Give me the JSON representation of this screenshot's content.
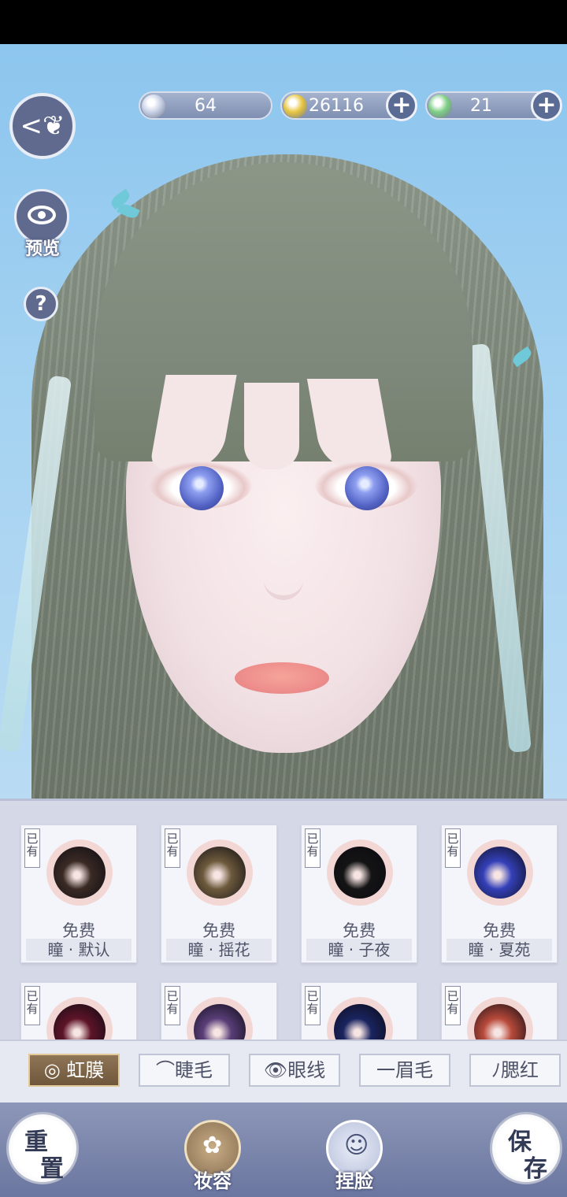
{
  "currencies": [
    {
      "name": "silver-token",
      "value": "64",
      "has_add": false,
      "color": "#c9d2e6"
    },
    {
      "name": "gold-coin",
      "value": "26116",
      "has_add": true,
      "color": "#e8c640"
    },
    {
      "name": "jade-token",
      "value": "21",
      "has_add": true,
      "color": "#7fcf86"
    }
  ],
  "left_controls": {
    "preview_label": "预览",
    "help_label": "?"
  },
  "iris_items": [
    {
      "owned": "已有",
      "price": "免费",
      "name": "瞳 · 默认",
      "color": "#3a2a24"
    },
    {
      "owned": "已有",
      "price": "免费",
      "name": "瞳 · 摇花",
      "color": "#6e5a3c"
    },
    {
      "owned": "已有",
      "price": "免费",
      "name": "瞳 · 子夜",
      "color": "#141414"
    },
    {
      "owned": "已有",
      "price": "免费",
      "name": "瞳 · 夏苑",
      "color": "#3440b8"
    },
    {
      "owned": "已有",
      "price": "",
      "name": "",
      "color": "#5e1428"
    },
    {
      "owned": "已有",
      "price": "",
      "name": "",
      "color": "#5a3e78"
    },
    {
      "owned": "已有",
      "price": "",
      "name": "",
      "color": "#1a2460"
    },
    {
      "owned": "已有",
      "price": "",
      "name": "",
      "color": "#b84a3a"
    }
  ],
  "category_tabs": [
    {
      "label": "◎ 虹膜",
      "active": true
    },
    {
      "label": "⌒睫毛",
      "active": false
    },
    {
      "label": "👁眼线",
      "active": false
    },
    {
      "label": "一眉毛",
      "active": false
    },
    {
      "label": "ﾉ腮红",
      "active": false
    }
  ],
  "bottom_bar": {
    "reset_label": [
      "重",
      "置"
    ],
    "makeup_label": "妆容",
    "face_label": "捏脸",
    "save_label": [
      "保",
      "存"
    ]
  },
  "colors": {
    "accent_dark": "#5f6a8e",
    "active_tab": "#7a6146",
    "panel_bg": "#d5d9e7"
  }
}
